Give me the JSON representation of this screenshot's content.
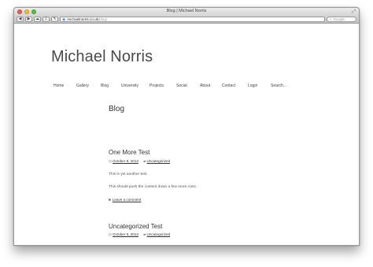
{
  "window": {
    "title": "Blog | Michael Norris",
    "toolbar": {
      "back": "◀",
      "forward": "▶",
      "reader": "☁",
      "share": "⇪",
      "tools": "✎",
      "url_host": "michaelnorris.co.uk",
      "url_path": "/blog/",
      "search_placeholder": "Google"
    }
  },
  "site": {
    "title": "Michael Norris",
    "nav": [
      "Home",
      "Gallery",
      "Blog",
      "University",
      "Projects",
      "Social",
      "About",
      "Contact",
      "Login",
      "Search…"
    ]
  },
  "main": {
    "heading": "Blog",
    "posts": [
      {
        "title": "One More Test",
        "date": "October 9, 2013",
        "category": "Uncategorized",
        "paragraphs": [
          "This is yet another test.",
          "This should push the content down a few more rows."
        ],
        "comment_link": "Leave a comment"
      },
      {
        "title": "Uncategorized Test",
        "date": "October 9, 2013",
        "category": "Uncategorized"
      }
    ]
  },
  "icons": {
    "clock": "◷",
    "folder": "▰",
    "comment": "■",
    "globe": "◉",
    "magnifier": "⌕",
    "fullscreen": "⤢"
  }
}
